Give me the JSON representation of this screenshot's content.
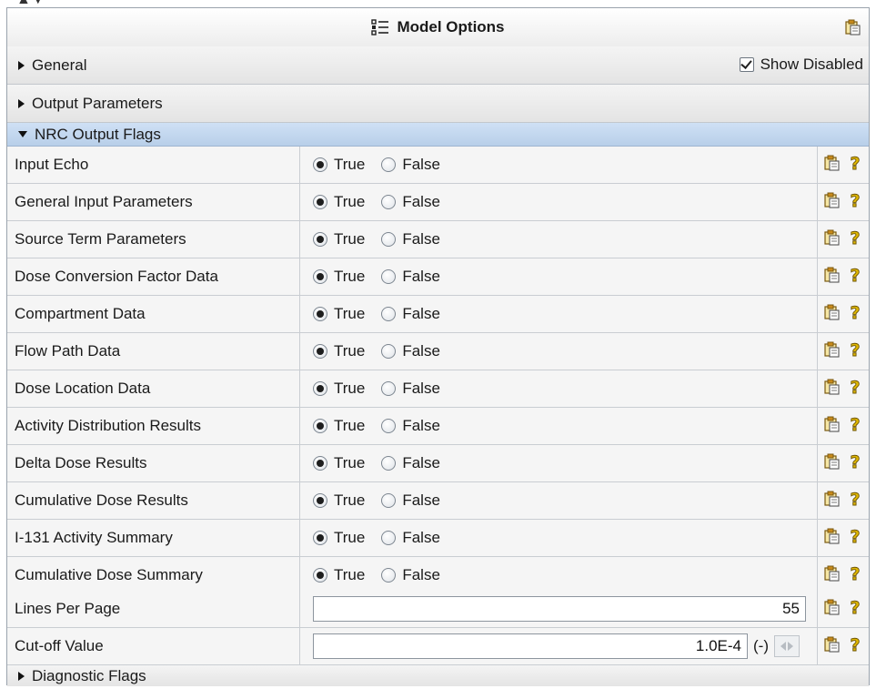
{
  "panel": {
    "title": "Model Options"
  },
  "sections": {
    "general": {
      "label": "General",
      "show_disabled_label": "Show Disabled",
      "show_disabled_checked": true
    },
    "output_parameters": {
      "label": "Output Parameters"
    },
    "nrc_output_flags": {
      "label": "NRC Output Flags"
    },
    "diagnostic_flags": {
      "label": "Diagnostic Flags"
    }
  },
  "options": {
    "true_label": "True",
    "false_label": "False"
  },
  "rows": [
    {
      "name": "Input Echo",
      "value": "True"
    },
    {
      "name": "General Input Parameters",
      "value": "True"
    },
    {
      "name": "Source Term Parameters",
      "value": "True"
    },
    {
      "name": "Dose Conversion Factor Data",
      "value": "True"
    },
    {
      "name": "Compartment Data",
      "value": "True"
    },
    {
      "name": "Flow Path Data",
      "value": "True"
    },
    {
      "name": "Dose Location Data",
      "value": "True"
    },
    {
      "name": "Activity Distribution Results",
      "value": "True"
    },
    {
      "name": "Delta Dose Results",
      "value": "True"
    },
    {
      "name": "Cumulative Dose Results",
      "value": "True"
    },
    {
      "name": "I-131 Activity Summary",
      "value": "True"
    },
    {
      "name": "Cumulative Dose Summary",
      "value": "True"
    }
  ],
  "lines_per_page": {
    "name": "Lines Per Page",
    "value": "55"
  },
  "cutoff": {
    "name": "Cut-off Value",
    "value": "1.0E-4",
    "unit": "(-)"
  },
  "icons": {
    "title": "list-icon",
    "row_copy": "clipboard-icon",
    "row_help": "help-icon"
  },
  "colors": {
    "expanded_header": "#c4d8ef",
    "help_icon": "#e0b800"
  }
}
